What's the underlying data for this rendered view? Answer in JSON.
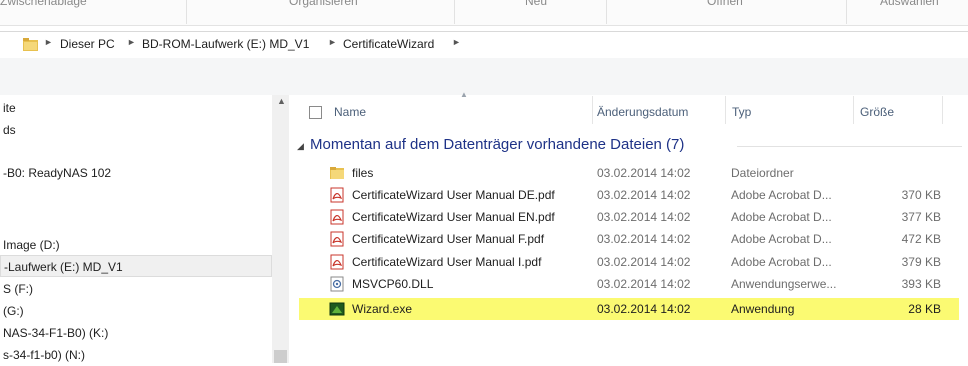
{
  "ribbon": {
    "groups": [
      "Zwischenablage",
      "Organisieren",
      "Neu",
      "Öffnen",
      "Auswählen"
    ]
  },
  "address": {
    "path": [
      "Dieser PC",
      "BD-ROM-Laufwerk (E:) MD_V1",
      "CertificateWizard"
    ]
  },
  "nav": {
    "items": [
      {
        "label": "ite"
      },
      {
        "label": "ds"
      },
      {
        "label": "-B0: ReadyNAS 102"
      },
      {
        "label": "Image (D:)"
      },
      {
        "label": "-Laufwerk (E:) MD_V1",
        "selected": true
      },
      {
        "label": "S (F:)"
      },
      {
        "label": "(G:)"
      },
      {
        "label": "NAS-34-F1-B0) (K:)"
      },
      {
        "label": "s-34-f1-b0) (N:)"
      }
    ]
  },
  "columns": {
    "name": "Name",
    "date": "Änderungsdatum",
    "type": "Typ",
    "size": "Größe"
  },
  "group": {
    "title": "Momentan auf dem Datenträger vorhandene Dateien (7)"
  },
  "files": [
    {
      "name": "files",
      "date": "03.02.2014 14:02",
      "type": "Dateiordner",
      "size": "",
      "icon": "folder-icon"
    },
    {
      "name": "CertificateWizard User Manual DE.pdf",
      "date": "03.02.2014 14:02",
      "type": "Adobe Acrobat D...",
      "size": "370 KB",
      "icon": "pdf-icon"
    },
    {
      "name": "CertificateWizard User Manual EN.pdf",
      "date": "03.02.2014 14:02",
      "type": "Adobe Acrobat D...",
      "size": "377 KB",
      "icon": "pdf-icon"
    },
    {
      "name": "CertificateWizard User Manual F.pdf",
      "date": "03.02.2014 14:02",
      "type": "Adobe Acrobat D...",
      "size": "472 KB",
      "icon": "pdf-icon"
    },
    {
      "name": "CertificateWizard User Manual I.pdf",
      "date": "03.02.2014 14:02",
      "type": "Adobe Acrobat D...",
      "size": "379 KB",
      "icon": "pdf-icon"
    },
    {
      "name": "MSVCP60.DLL",
      "date": "03.02.2014 14:02",
      "type": "Anwendungserwe...",
      "size": "393 KB",
      "icon": "dll-icon"
    },
    {
      "name": "Wizard.exe",
      "date": "03.02.2014 14:02",
      "type": "Anwendung",
      "size": "28 KB",
      "icon": "exe-icon",
      "highlighted": true
    }
  ],
  "colors": {
    "highlight": "#fbfa72",
    "group_title": "#1e3287",
    "column_header": "#4c607a"
  }
}
